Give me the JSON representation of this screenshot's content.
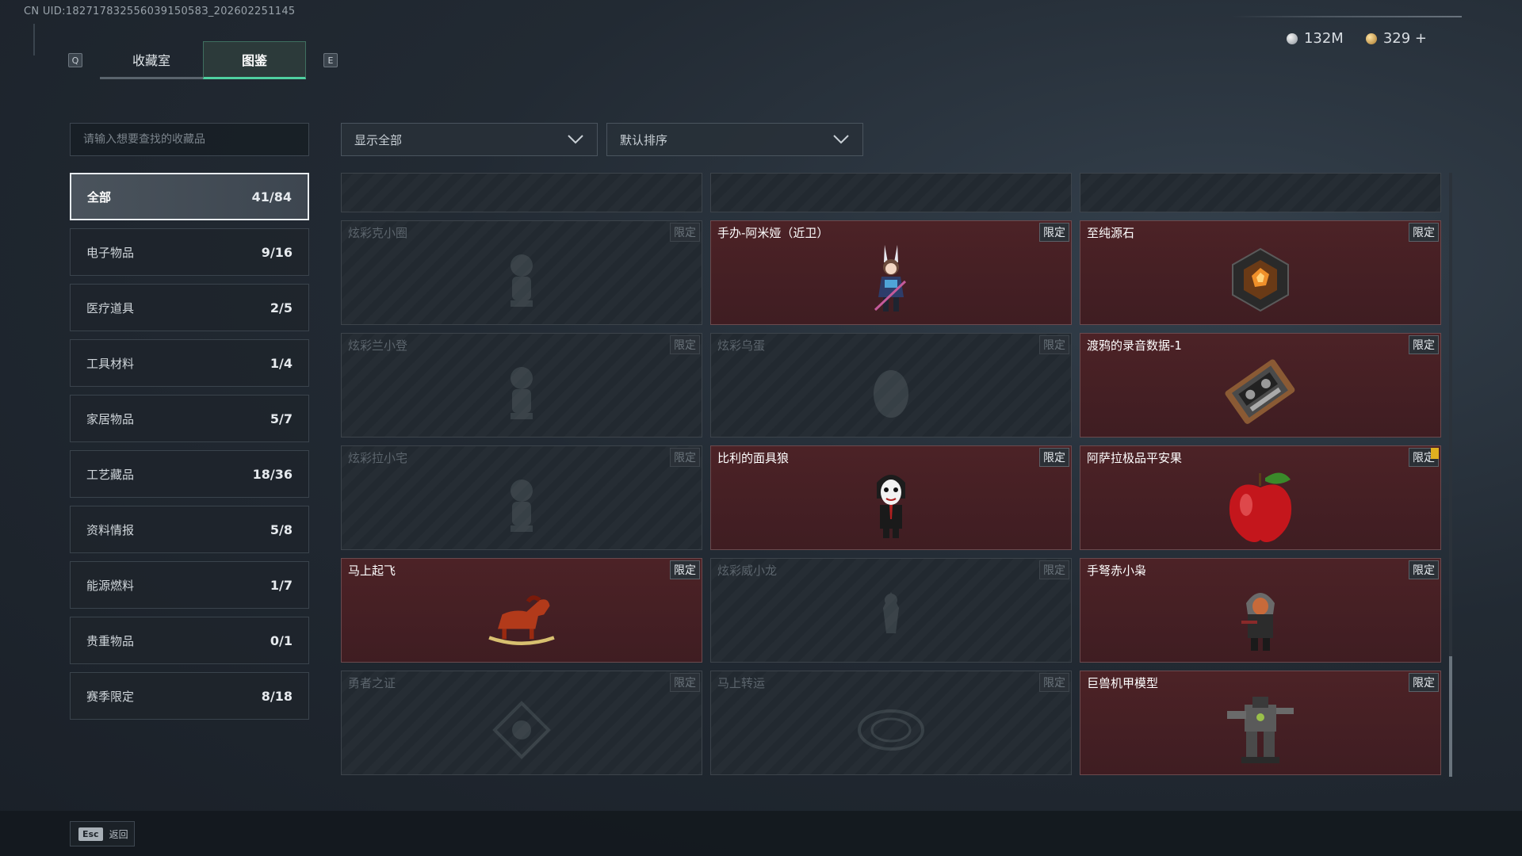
{
  "uid": "CN UID:18271783255603915058З_202602251145",
  "tabs": {
    "left_key": "Q",
    "right_key": "E",
    "items": [
      {
        "label": "收藏室"
      },
      {
        "label": "图鉴"
      }
    ]
  },
  "currency": {
    "silver": "132M",
    "gold": "329 +"
  },
  "search": {
    "placeholder": "请输入想要查找的收藏品"
  },
  "filters": {
    "display": "显示全部",
    "sort": "默认排序"
  },
  "categories": [
    {
      "label": "全部",
      "count": "41/84"
    },
    {
      "label": "电子物品",
      "count": "9/16"
    },
    {
      "label": "医疗道具",
      "count": "2/5"
    },
    {
      "label": "工具材料",
      "count": "1/4"
    },
    {
      "label": "家居物品",
      "count": "5/7"
    },
    {
      "label": "工艺藏品",
      "count": "18/36"
    },
    {
      "label": "资料情报",
      "count": "5/8"
    },
    {
      "label": "能源燃料",
      "count": "1/7"
    },
    {
      "label": "贵重物品",
      "count": "0/1"
    },
    {
      "label": "赛季限定",
      "count": "8/18"
    }
  ],
  "badge_label": "限定",
  "items": [
    {
      "name": "炫彩克小圈",
      "owned": false,
      "icon": "figurine-icon"
    },
    {
      "name": "手办-阿米娅（近卫）",
      "owned": true,
      "icon": "amiya-figure-icon"
    },
    {
      "name": "至纯源石",
      "owned": true,
      "icon": "originium-crystal-icon"
    },
    {
      "name": "炫彩兰小登",
      "owned": false,
      "icon": "figurine-icon"
    },
    {
      "name": "炫彩乌蛋",
      "owned": false,
      "icon": "egg-icon"
    },
    {
      "name": "渡鸦的录音数据-1",
      "owned": true,
      "icon": "cassette-tape-icon"
    },
    {
      "name": "炫彩拉小宅",
      "owned": false,
      "icon": "figurine-icon"
    },
    {
      "name": "比利的面具狼",
      "owned": true,
      "icon": "masked-puppet-icon"
    },
    {
      "name": "阿萨拉极品平安果",
      "owned": true,
      "icon": "red-apple-icon",
      "warning": true
    },
    {
      "name": "马上起飞",
      "owned": true,
      "icon": "rocking-horse-icon"
    },
    {
      "name": "炫彩威小龙",
      "owned": false,
      "icon": "dragon-figure-icon"
    },
    {
      "name": "手弩赤小枭",
      "owned": true,
      "icon": "hooded-figure-icon"
    },
    {
      "name": "勇者之证",
      "owned": false,
      "icon": "emblem-icon"
    },
    {
      "name": "马上转运",
      "owned": false,
      "icon": "coin-emblem-icon"
    },
    {
      "name": "巨兽机甲模型",
      "owned": true,
      "icon": "mech-model-icon"
    }
  ],
  "footer": {
    "esc_key": "Esc",
    "back_label": "返回"
  },
  "colors": {
    "owned_card": "#4c2226",
    "locked_card": "#222930",
    "active_tab_underline": "#4fd0a0"
  }
}
